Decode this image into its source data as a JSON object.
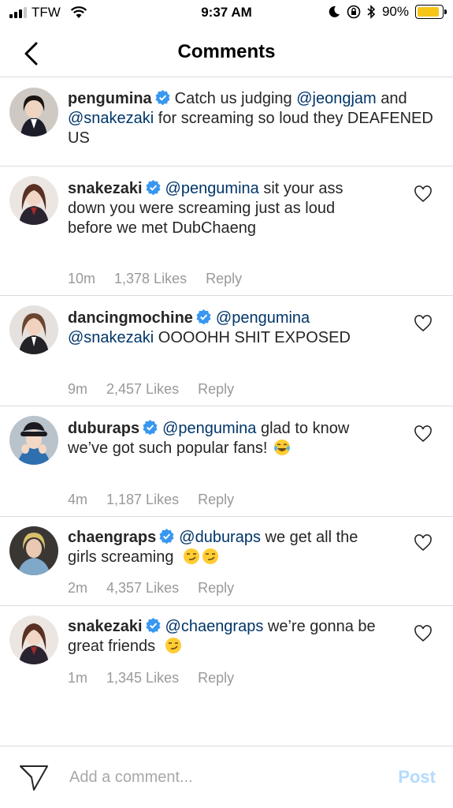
{
  "status_bar": {
    "carrier": "TFW",
    "time": "9:37 AM",
    "battery_percent": "90%",
    "battery_level": 0.9,
    "icons": [
      "signal-icon",
      "wifi-icon",
      "moon-icon",
      "rotation-lock-icon",
      "bluetooth-icon",
      "battery-icon"
    ]
  },
  "nav": {
    "title": "Comments",
    "back_icon": "chevron-left-icon"
  },
  "caption": {
    "username": "pengumina",
    "text_1": "Catch us judging ",
    "mention_1": "@jeongjam",
    "text_2": " and ",
    "mention_2": "@snakezaki",
    "text_3": " for screaming so loud they DEAFENED US"
  },
  "comments": [
    {
      "username": "snakezaki",
      "mention": "@pengumina",
      "text": " sit your ass down you were screaming just as loud before we met DubChaeng",
      "time": "10m",
      "likes": "1,378 Likes",
      "reply": "Reply"
    },
    {
      "username": "dancingmochine",
      "mention": "@pengumina",
      "mention_2": "@snakezaki",
      "text": " OOOOHH SHIT EXPOSED",
      "time": "9m",
      "likes": "2,457 Likes",
      "reply": "Reply"
    },
    {
      "username": "duburaps",
      "mention": "@pengumina",
      "text": " glad to know we’ve got such popular fans!",
      "emoji": "tears-of-joy-emoji",
      "time": "4m",
      "likes": "1,187 Likes",
      "reply": "Reply"
    },
    {
      "username": "chaengraps",
      "mention": "@duburaps",
      "text": " we get all the girls screaming",
      "emoji": "smirk-emoji",
      "time": "2m",
      "likes": "4,357 Likes",
      "reply": "Reply"
    },
    {
      "username": "snakezaki",
      "mention": "@chaengraps",
      "text": " we’re gonna be great friends",
      "emoji": "smirk-emoji",
      "time": "1m",
      "likes": "1,345 Likes",
      "reply": "Reply"
    }
  ],
  "input_bar": {
    "placeholder": "Add a comment...",
    "post_label": "Post",
    "send_icon": "paper-plane-icon"
  },
  "colors": {
    "mention": "#003569",
    "meta": "#999999",
    "post_disabled": "#b3dbff",
    "verified": "#3897f0",
    "battery": "#f5c518"
  }
}
